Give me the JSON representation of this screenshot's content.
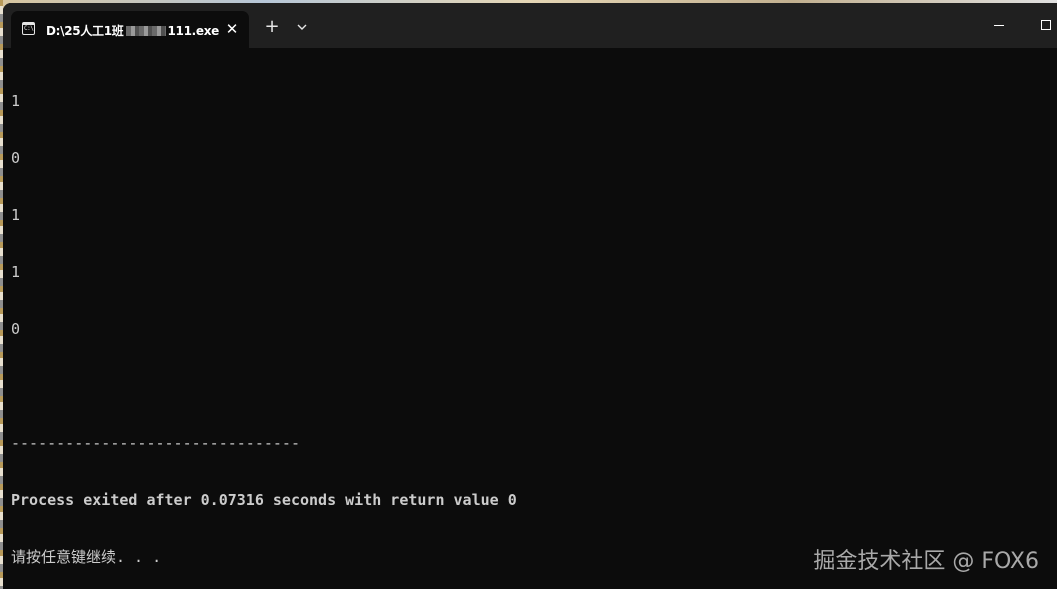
{
  "window": {
    "tab_title_prefix": "D:\\25人工1班",
    "tab_title_suffix": "111.exe",
    "tab_icon_glyph": "C:\\",
    "icons": {
      "tab_icon": "console-icon",
      "tab_close": "close-icon",
      "new_tab": "plus-icon",
      "tab_dropdown": "chevron-down-icon",
      "minimize": "minimize-icon",
      "maximize": "maximize-icon"
    },
    "close_glyph": "✕",
    "new_tab_glyph": "+"
  },
  "console": {
    "outputs": [
      "1",
      "0",
      "1",
      "1",
      "0"
    ],
    "separator": "--------------------------------",
    "process_message": "Process exited after 0.07316 seconds with return value 0",
    "continue_prompt": "请按任意键继续. . ."
  },
  "watermark": {
    "text": "掘金技术社区 @ FOX6"
  },
  "colors": {
    "background": "#0c0c0c",
    "titlebar": "#202020",
    "text": "#cccccc",
    "watermark": "#a9a9a9"
  }
}
